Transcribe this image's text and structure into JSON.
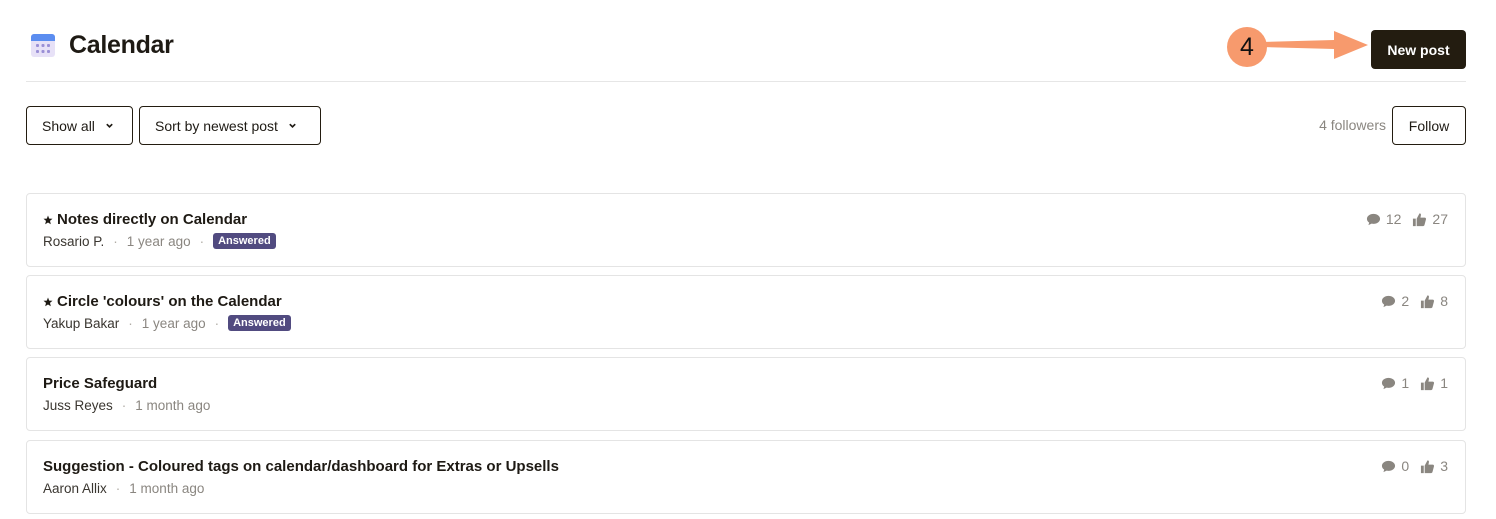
{
  "header": {
    "title": "Calendar",
    "new_post_label": "New post",
    "step_number": "4"
  },
  "controls": {
    "show_all_label": "Show all",
    "sort_label": "Sort by newest post",
    "followers_text": "4 followers",
    "follow_label": "Follow"
  },
  "posts": [
    {
      "title": "Notes directly on Calendar",
      "pinned": true,
      "author": "Rosario P.",
      "time": "1 year ago",
      "badge": "Answered",
      "comments": "12",
      "likes": "27"
    },
    {
      "title": "Circle 'colours' on the Calendar",
      "pinned": true,
      "author": "Yakup Bakar",
      "time": "1 year ago",
      "badge": "Answered",
      "comments": "2",
      "likes": "8"
    },
    {
      "title": "Price Safeguard",
      "pinned": false,
      "author": "Juss Reyes",
      "time": "1 month ago",
      "comments": "1",
      "likes": "1"
    },
    {
      "title": "Suggestion - Coloured tags on calendar/dashboard for Extras or Upsells",
      "pinned": false,
      "author": "Aaron Allix",
      "time": "1 month ago",
      "comments": "0",
      "likes": "3"
    }
  ],
  "icons": {
    "calendar": "calendar-icon",
    "pinned": "star-icon",
    "comments": "comment-icon",
    "likes": "thumbs-up-icon",
    "dropdown": "chevron-down-icon"
  },
  "colors": {
    "primary_button": "#231c10",
    "badge": "#514b80",
    "annotation": "#f79a6d"
  }
}
